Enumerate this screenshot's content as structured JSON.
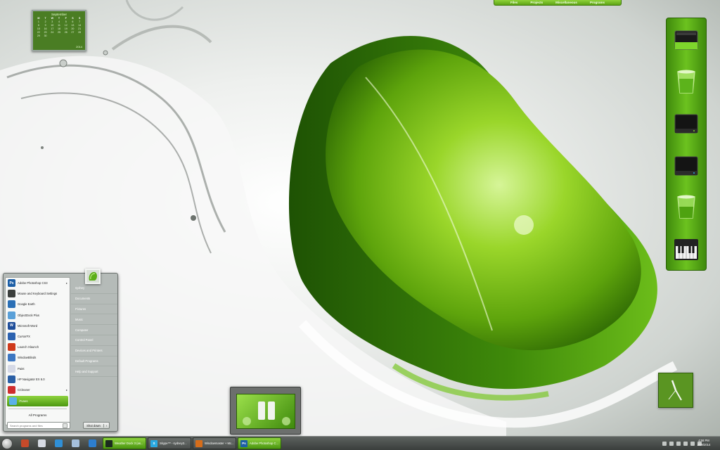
{
  "colors": {
    "accent_green": "#6cc21f",
    "taskbar": "#4a4e4c",
    "start_menu_bg": "#b5bbb8"
  },
  "topbar": {
    "items": [
      "Files",
      "Projects",
      "Miscellaneous",
      "Programs"
    ]
  },
  "calendar": {
    "month": "September",
    "year": "2014",
    "day_headers": [
      "M",
      "T",
      "W",
      "T",
      "F",
      "S",
      "S"
    ],
    "days": [
      "1",
      "2",
      "3",
      "4",
      "5",
      "6",
      "7",
      "8",
      "9",
      "10",
      "11",
      "12",
      "13",
      "14",
      "15",
      "16",
      "17",
      "18",
      "19",
      "20",
      "21",
      "22",
      "23",
      "24",
      "25",
      "26",
      "27",
      "28",
      "29",
      "30"
    ]
  },
  "dock": {
    "items": [
      {
        "name": "drive",
        "icon": "hard-drive-icon"
      },
      {
        "name": "recycle bin full",
        "icon": "glass-bin-icon"
      },
      {
        "name": "drive black",
        "icon": "hard-drive-icon"
      },
      {
        "name": "drive black 2",
        "icon": "hard-drive-icon"
      },
      {
        "name": "recycle bin",
        "icon": "glass-bin-icon"
      },
      {
        "name": "piano",
        "icon": "piano-keyboard-icon"
      }
    ]
  },
  "start_menu": {
    "programs": [
      {
        "label": "Adobe Photoshop CS3",
        "icon": "photoshop-icon",
        "color": "#1d5fa6",
        "glyph": "Ps",
        "submenu": true
      },
      {
        "label": "Mouse and Keyboard Settings",
        "icon": "mouse-keyboard-icon",
        "color": "#3b3f3d",
        "glyph": "",
        "submenu": false
      },
      {
        "label": "Google Earth",
        "icon": "globe-icon",
        "color": "#2a6fb5",
        "glyph": "",
        "submenu": false
      },
      {
        "label": "ObjectDock Plus",
        "icon": "objectdock-icon",
        "color": "#5aa0d8",
        "glyph": "",
        "submenu": false
      },
      {
        "label": "Microsoft Word",
        "icon": "word-icon",
        "color": "#1f4e9a",
        "glyph": "W",
        "submenu": false
      },
      {
        "label": "CursorFX",
        "icon": "cursor-icon",
        "color": "#2c62b0",
        "glyph": "",
        "submenu": false
      },
      {
        "label": "Launch Xlaunch",
        "icon": "xlaunch-icon",
        "color": "#cf3a1c",
        "glyph": "",
        "submenu": false
      },
      {
        "label": "WindowBlinds",
        "icon": "windowblinds-icon",
        "color": "#3d77c2",
        "glyph": "",
        "submenu": false
      },
      {
        "label": "Paint",
        "icon": "paint-icon",
        "color": "#d5d9e6",
        "glyph": "",
        "submenu": false
      },
      {
        "label": "HP Navigator EX 6.0",
        "icon": "navigator-icon",
        "color": "#2b5fa5",
        "glyph": "",
        "submenu": false
      },
      {
        "label": "CCleaner",
        "icon": "ccleaner-icon",
        "color": "#cf2d2d",
        "glyph": "",
        "submenu": true
      },
      {
        "label": "iTunes",
        "icon": "itunes-icon",
        "color": "#5bb1e8",
        "glyph": "",
        "submenu": false,
        "highlight": true
      }
    ],
    "all_programs": "All Programs",
    "search_placeholder": "Search programs and files",
    "right_items": [
      "sydney",
      "Documents",
      "Pictures",
      "Music",
      "Computer",
      "Control Panel",
      "Devices and Printers",
      "Default Programs",
      "Help and Support"
    ],
    "shutdown": "Shut down"
  },
  "taskbar": {
    "pinned": [
      {
        "name": "media-player",
        "icon": "media-player-icon"
      },
      {
        "name": "documents",
        "icon": "document-icon"
      },
      {
        "name": "dropbox",
        "icon": "dropbox-icon"
      },
      {
        "name": "notes",
        "icon": "note-icon"
      },
      {
        "name": "internet-explorer",
        "icon": "internet-explorer-icon"
      }
    ],
    "tasks": [
      {
        "label": "Weather Dock 3 (as...",
        "icon": "weather-icon",
        "color": "#1b2a1f",
        "glyph": "",
        "active": true
      },
      {
        "label": "Skype™ - sydney3...",
        "icon": "skype-icon",
        "color": "#29a9e0",
        "glyph": "S",
        "active": false
      },
      {
        "label": "Windowmaster + Mc...",
        "icon": "firefox-icon",
        "color": "#d66d1a",
        "glyph": "",
        "active": false
      },
      {
        "label": "Adobe Photoshop C...",
        "icon": "photoshop-icon",
        "color": "#1d5fa6",
        "glyph": "Ps",
        "active": true
      }
    ],
    "time": "4:58 PM",
    "date": "2/09/2014"
  }
}
